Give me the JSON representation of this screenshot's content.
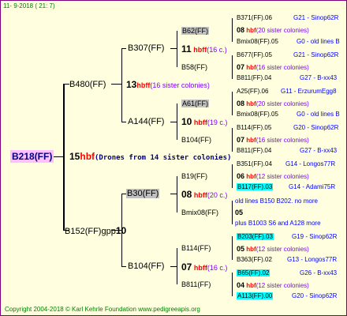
{
  "header": "11-  9-2018 (  21:  7)",
  "footer": "Copyright 2004-2018 © Karl Kehrle Foundation    www.pedigreeapis.org",
  "root": {
    "name": "B218(FF)",
    "count": "15",
    "hbf": "hbf",
    "note": "(Drones from 14 sister colonies)"
  },
  "g1": {
    "upper": "B480(FF)",
    "lower": "B152(FF)gpp",
    "lower_count": "10",
    "upper_count": "13",
    "upper_hbf": "hbff",
    "upper_note": "(16 sister colonies)"
  },
  "g2": {
    "b307": "B307(FF)",
    "a144": "A144(FF)",
    "a144_count": "10",
    "a144_hbf": "hbff",
    "a144_note": "(19 c.)",
    "b30": "B30(FF)",
    "b30_count": "08",
    "b30_hbf": "hbff",
    "b30_note": "(20 c.)",
    "b104": "B104(FF)",
    "b104_count": "07",
    "b104_hbf": "hbff",
    "b104_note": "(16 c.)"
  },
  "g3": {
    "b62": "B62(FF)",
    "b62_count": "11",
    "b62_hbf": "hbff",
    "b62_note": "(16 c.)",
    "b58": "B58(FF)",
    "a61": "A61(FF)",
    "b104b": "B104(FF)",
    "b19": "B19(FF)",
    "bmix08": "Bmix08(FF)",
    "b114": "B114(FF)",
    "b811": "B811(FF)"
  },
  "g4": [
    {
      "l": "B371(FF).06",
      "r": "G21 - Sinop62R"
    },
    {
      "c": "08",
      "h": "hbf",
      "n": "(20 sister colonies)"
    },
    {
      "l": "Bmix08(FF).05",
      "r": "G0 - old lines B"
    },
    {
      "l": "B677(FF).05",
      "r": "G21 - Sinop62R"
    },
    {
      "c": "07",
      "h": "hbf",
      "n": "(16 sister colonies)"
    },
    {
      "l": "B811(FF).04",
      "r": "G27 - B-xx43"
    },
    {
      "l": "A25(FF).06",
      "r": "G11 - ErzurumEgg8"
    },
    {
      "c": "08",
      "h": "hbf",
      "n": "(20 sister colonies)"
    },
    {
      "l": "Bmix08(FF).05",
      "r": "G0 - old lines B"
    },
    {
      "l": "B114(FF).05",
      "r": "G20 - Sinop62R"
    },
    {
      "c": "07",
      "h": "hbf",
      "n": "(16 sister colonies)"
    },
    {
      "l": "B811(FF).04",
      "r": "G27 - B-xx43"
    },
    {
      "l": "B351(FF).04",
      "r": "G14 - Longos77R"
    },
    {
      "c": "06",
      "h": "hbf",
      "n": "(12 sister colonies)"
    },
    {
      "l": "B117(FF).03",
      "r": "G14 - Adami75R"
    },
    {
      "l": "old lines B150  B202.   no more"
    },
    {
      "c": "05"
    },
    {
      "l": "plus B1003  S6 and A128 more"
    },
    {
      "l": "B203(FF).03",
      "r": "G19 - Sinop62R"
    },
    {
      "c": "05",
      "h": "hbf",
      "n": "(12 sister colonies)"
    },
    {
      "l": "B363(FF).02",
      "r": "G13 - Longos77R"
    },
    {
      "l": "B65(FF).02",
      "r": "G26 - B-xx43"
    },
    {
      "c": "04",
      "h": "hbf",
      "n": "(12 sister colonies)"
    },
    {
      "l": "A113(FF).00",
      "r": "G20 - Sinop62R"
    }
  ]
}
